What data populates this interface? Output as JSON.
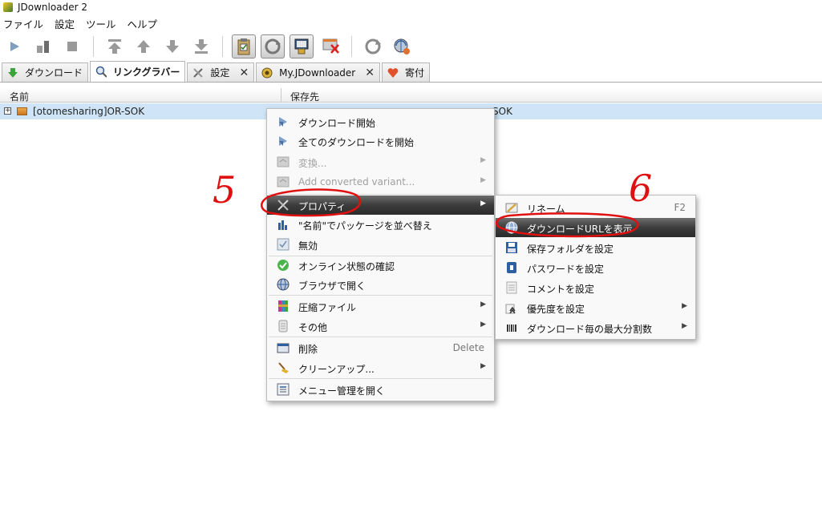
{
  "window": {
    "title": "JDownloader 2"
  },
  "menubar": {
    "items": [
      "ファイル",
      "設定",
      "ツール",
      "ヘルプ"
    ]
  },
  "toolbar": {
    "icons": [
      "play-icon",
      "pause-download-icon",
      "stop-icon",
      "move-top-icon",
      "move-up-icon",
      "move-down-icon",
      "move-bottom-icon",
      "clipboard-observer-icon",
      "auto-reconnect-icon",
      "premium-toggle-icon",
      "silent-mode-icon",
      "reconnect-icon",
      "update-check-icon"
    ]
  },
  "tabs": [
    {
      "label": "ダウンロード",
      "icon": "download-arrow-icon",
      "active": false,
      "closable": false
    },
    {
      "label": "リンクグラバー",
      "icon": "linkgrabber-icon",
      "active": true,
      "closable": false
    },
    {
      "label": "設定",
      "icon": "tools-icon",
      "active": false,
      "closable": true
    },
    {
      "label": "My.JDownloader",
      "icon": "myjd-icon",
      "active": false,
      "closable": true
    },
    {
      "label": "寄付",
      "icon": "heart-icon",
      "active": false,
      "closable": false
    }
  ],
  "close_symbol": "✕",
  "table": {
    "columns": [
      "名前",
      "保存先"
    ],
    "rows": [
      {
        "expander": "+",
        "name": "[otomesharing]OR-SOK",
        "path": "SOK"
      }
    ]
  },
  "context_menu": {
    "items": [
      {
        "label": "ダウンロード開始",
        "icon": "start-download-icon"
      },
      {
        "label": "全てのダウンロードを開始",
        "icon": "start-all-icon"
      },
      {
        "label": "変換...",
        "icon": "convert-icon",
        "disabled": true,
        "submenu": true
      },
      {
        "label": "Add converted variant...",
        "icon": "convert-variant-icon",
        "disabled": true,
        "submenu": true
      },
      {
        "label": "プロパティ",
        "icon": "properties-icon",
        "highlighted": true,
        "submenu": true
      },
      {
        "label": "\"名前\"でパッケージを並べ替え",
        "icon": "sort-icon"
      },
      {
        "label": "無効",
        "icon": "disable-icon"
      },
      {
        "label": "オンライン状態の確認",
        "icon": "check-online-icon"
      },
      {
        "label": "ブラウザで開く",
        "icon": "browser-icon"
      },
      {
        "label": "圧縮ファイル",
        "icon": "archive-icon",
        "submenu": true
      },
      {
        "label": "その他",
        "icon": "other-icon",
        "submenu": true
      },
      {
        "label": "削除",
        "icon": "delete-icon",
        "shortcut": "Delete"
      },
      {
        "label": "クリーンアップ...",
        "icon": "cleanup-icon",
        "submenu": true
      },
      {
        "label": "メニュー管理を開く",
        "icon": "menu-manager-icon"
      }
    ]
  },
  "submenu": {
    "items": [
      {
        "label": "リネーム",
        "icon": "rename-icon",
        "shortcut": "F2"
      },
      {
        "label": "ダウンロードURLを表示",
        "icon": "globe-icon",
        "highlighted": true
      },
      {
        "label": "保存フォルダを設定",
        "icon": "save-folder-icon"
      },
      {
        "label": "パスワードを設定",
        "icon": "lock-icon"
      },
      {
        "label": "コメントを設定",
        "icon": "comment-icon"
      },
      {
        "label": "優先度を設定",
        "icon": "priority-icon",
        "submenu": true
      },
      {
        "label": "ダウンロード毎の最大分割数",
        "icon": "chunks-icon",
        "submenu": true
      }
    ]
  },
  "submenu_arrow": "▶",
  "annotations": {
    "step5": "5",
    "step6": "6",
    "color": "#e01010"
  },
  "colors": {
    "selected_row": "#cfe5f7",
    "menu_highlight": "#3c3c3c",
    "annotation_red": "#e01010"
  }
}
